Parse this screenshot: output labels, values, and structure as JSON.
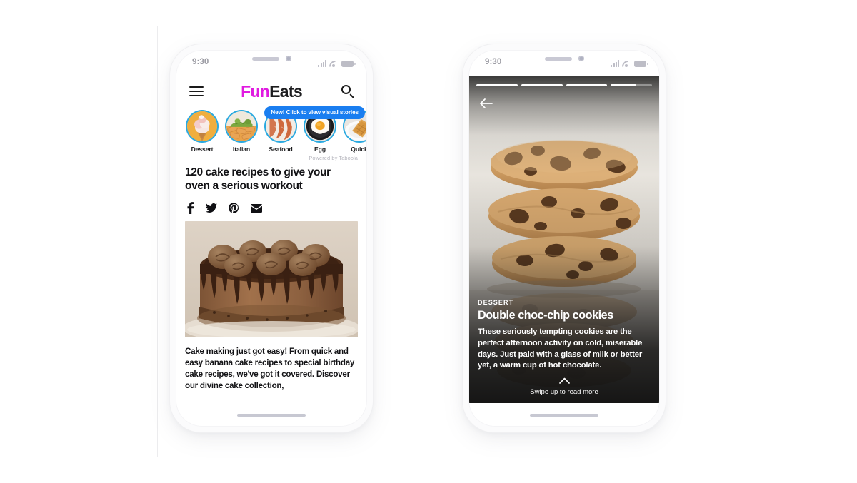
{
  "canvas": {
    "background": "#ffffff",
    "divider_color": "#ececee"
  },
  "phone_left": {
    "status_bar": {
      "time": "9:30",
      "signal_icon": "cellular-signal-icon",
      "wifi_icon": "wifi-icon",
      "battery_icon": "battery-icon"
    },
    "header": {
      "menu_icon": "hamburger-menu-icon",
      "brand_part_1": "Fun",
      "brand_part_2": "Eats",
      "brand_color_1": "#e01ae0",
      "brand_color_2": "#1d1d1f",
      "search_icon": "search-icon"
    },
    "stories": {
      "badge_label": "New! Click to view visual stories",
      "badge_color": "#1a7ef0",
      "ring_color": "#2aa9e0",
      "attribution": "Powered by Taboola",
      "items": [
        {
          "label": "Dessert",
          "thumb": "ice-cream-cone-thumb"
        },
        {
          "label": "Italian",
          "thumb": "pasta-penne-thumb"
        },
        {
          "label": "Seafood",
          "thumb": "shrimp-thumb"
        },
        {
          "label": "Egg",
          "thumb": "fried-egg-pan-thumb"
        },
        {
          "label": "Quick",
          "thumb": "toasted-sandwich-thumb"
        }
      ]
    },
    "article": {
      "headline": "120 cake recipes to give your oven a serious workout",
      "share": [
        {
          "name": "facebook-icon",
          "label": "Facebook"
        },
        {
          "name": "twitter-icon",
          "label": "Twitter"
        },
        {
          "name": "pinterest-icon",
          "label": "Pinterest"
        },
        {
          "name": "email-icon",
          "label": "Email"
        }
      ],
      "hero_image": "chocolate-layer-cake-photo",
      "body": "Cake making just got easy! From quick and easy banana cake recipes to special birthday cake recipes, we've got it covered. Discover our divine cake collection,"
    },
    "home_indicator": "home-indicator"
  },
  "phone_right": {
    "status_bar": {
      "time": "9:30",
      "signal_icon": "cellular-signal-icon",
      "wifi_icon": "wifi-icon",
      "battery_icon": "battery-icon"
    },
    "story": {
      "progress": [
        100,
        100,
        100,
        62
      ],
      "back_icon": "back-arrow-icon",
      "background_image": "stacked-chocolate-chip-cookies-photo",
      "kicker": "DESSERT",
      "title": "Double choc-chip cookies",
      "body": "These seriously tempting cookies are the perfect afternoon activity on cold, miserable days. Just paid with a glass of milk or better yet, a warm cup of hot chocolate.",
      "swipe_icon": "chevron-up-icon",
      "swipe_label": "Swipe up to read more"
    },
    "home_indicator": "home-indicator"
  }
}
